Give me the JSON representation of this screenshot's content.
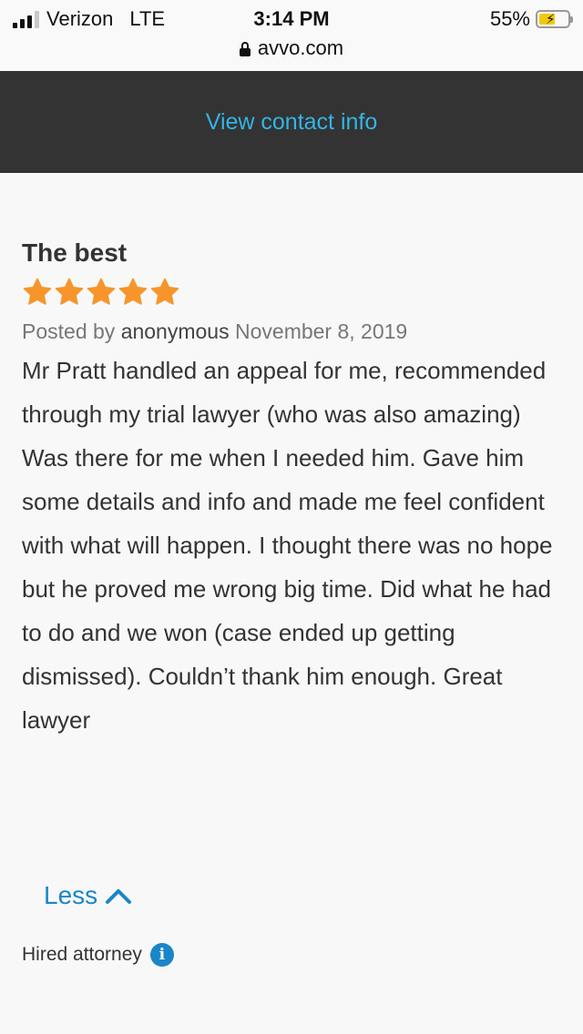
{
  "status_bar": {
    "carrier": "Verizon",
    "network": "LTE",
    "time": "3:14 PM",
    "battery": "55%",
    "battery_level": 0.55,
    "url": "avvo.com"
  },
  "contact_bar": {
    "label": "View contact info"
  },
  "review": {
    "title": "The best",
    "rating": 5,
    "star_color": "#f7952b",
    "posted_prefix": "Posted by",
    "author": "anonymous",
    "date": "November 8, 2019",
    "body": "Mr Pratt handled an appeal for me, recommended through my trial lawyer (who was also amazing) Was there for me when I needed him. Gave him some details and info and made me feel confident with what will happen. I thought there was no hope but he proved me wrong big time. Did what he had to do and we won (case ended up getting dismissed). Couldn’t thank him enough. Great lawyer"
  },
  "less_toggle": {
    "label": "Less"
  },
  "hired": {
    "label": "Hired attorney",
    "icon": "info-icon"
  },
  "colors": {
    "link_blue": "#1a86c8",
    "contact_link": "#33b5e5",
    "dark_bar": "#333333"
  }
}
